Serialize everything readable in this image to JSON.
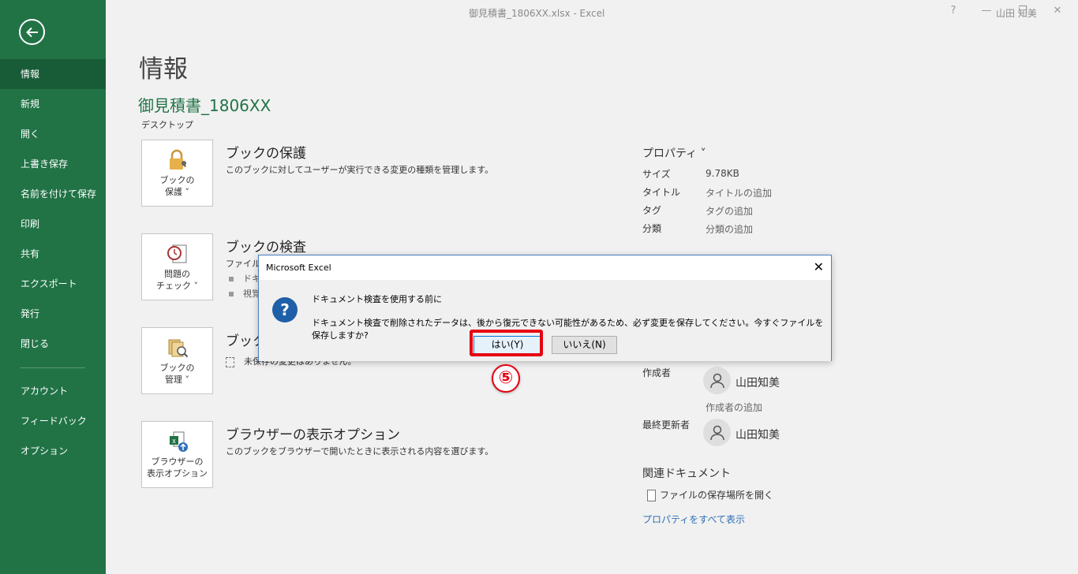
{
  "window": {
    "title": "御見積書_1806XX.xlsx  -  Excel",
    "user": "山田 知美",
    "help": "?",
    "minimize": "—",
    "restore": "❐",
    "close": "✕"
  },
  "sidebar": {
    "items": [
      {
        "label": "情報",
        "active": true
      },
      {
        "label": "新規"
      },
      {
        "label": "開く"
      },
      {
        "label": "上書き保存"
      },
      {
        "label": "名前を付けて保存"
      },
      {
        "label": "印刷"
      },
      {
        "label": "共有"
      },
      {
        "label": "エクスポート"
      },
      {
        "label": "発行"
      },
      {
        "label": "閉じる"
      },
      {
        "label": "アカウント"
      },
      {
        "label": "フィードバック"
      },
      {
        "label": "オプション"
      }
    ]
  },
  "main": {
    "title": "情報",
    "file_name": "御見積書_1806XX",
    "location": "デスクトップ",
    "sections": [
      {
        "tile_line1": "ブックの",
        "tile_line2": "保護 ˅",
        "title": "ブックの保護",
        "desc": "このブックに対してユーザーが実行できる変更の種類を管理します。",
        "icon": "lock-icon"
      },
      {
        "tile_line1": "問題の",
        "tile_line2": "チェック ˅",
        "title": "ブックの検査",
        "desc": "ファイルを",
        "bullets": [
          "ドキ",
          "視覚"
        ],
        "icon": "inspect-icon"
      },
      {
        "tile_line1": "ブックの",
        "tile_line2": "管理 ˅",
        "title": "ブックの",
        "desc": "未保存の変更はありません。",
        "icon": "manage-icon"
      },
      {
        "tile_line1": "ブラウザーの",
        "tile_line2": "表示オプション",
        "title": "ブラウザーの表示オプション",
        "desc": "このブックをブラウザーで開いたときに表示される内容を選びます。",
        "icon": "browser-options-icon"
      }
    ]
  },
  "properties": {
    "header": "プロパティ ˅",
    "rows": [
      {
        "key": "サイズ",
        "value": "9.78KB"
      },
      {
        "key": "タイトル",
        "value": "タイトルの追加"
      },
      {
        "key": "タグ",
        "value": "タグの追加"
      },
      {
        "key": "分類",
        "value": "分類の追加"
      }
    ],
    "author_label": "作成者",
    "author_name": "山田知美",
    "add_author": "作成者の追加",
    "last_modified_label": "最終更新者",
    "last_modified_name": "山田知美",
    "related_title": "関連ドキュメント",
    "open_location": "ファイルの保存場所を開く",
    "show_all": "プロパティをすべて表示"
  },
  "dialog": {
    "title": "Microsoft Excel",
    "heading": "ドキュメント検査を使用する前に",
    "message": "ドキュメント検査で削除されたデータは、後から復元できない可能性があるため、必ず変更を保存してください。今すぐファイルを保存しますか?",
    "yes_label": "はい(Y)",
    "no_label": "いいえ(N)",
    "icon": "question-icon"
  },
  "annotation": {
    "step": "5",
    "step_display": "⑤",
    "highlight_color": "#e60012"
  },
  "colors": {
    "sidebar": "#217346",
    "sidebar_active": "#185c37",
    "accent_text": "#217346"
  }
}
